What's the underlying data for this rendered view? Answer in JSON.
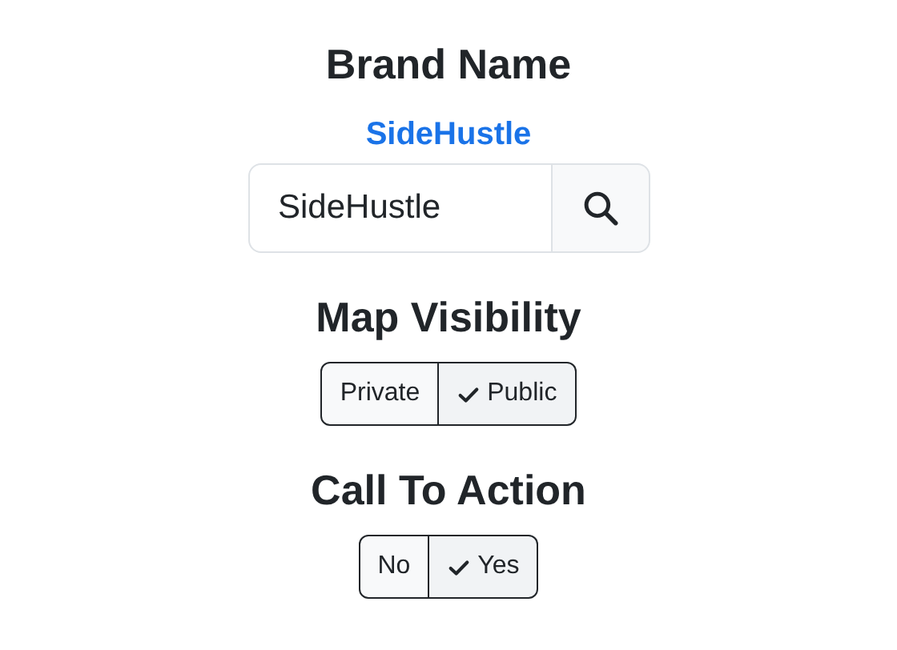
{
  "brand": {
    "heading": "Brand Name",
    "link": "SideHustle",
    "field_value": "SideHustle"
  },
  "sections": [
    {
      "heading": "Map Visibility",
      "options": [
        {
          "label": "Private",
          "selected": false
        },
        {
          "label": "Public",
          "selected": true
        }
      ]
    },
    {
      "heading": "Call To Action",
      "options": [
        {
          "label": "No",
          "selected": false
        },
        {
          "label": "Yes",
          "selected": true
        }
      ]
    }
  ]
}
